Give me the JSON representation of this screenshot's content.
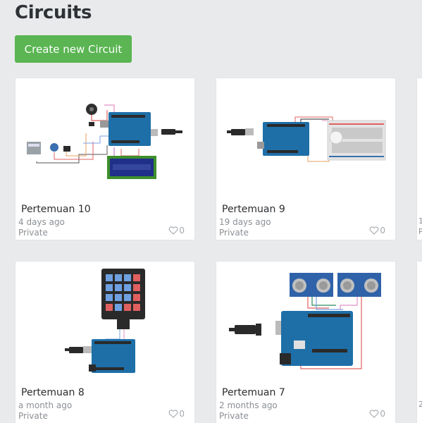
{
  "page": {
    "title": "Circuits"
  },
  "actions": {
    "create_label": "Create new Circuit"
  },
  "circuits": [
    {
      "name": "Pertemuan 10",
      "date": "4 days ago",
      "visibility": "Private",
      "likes": "0",
      "thumbnail": "arduino-lcd-circuit"
    },
    {
      "name": "Pertemuan 9",
      "date": "19 days ago",
      "visibility": "Private",
      "likes": "0",
      "thumbnail": "arduino-breadboard-circuit"
    },
    {
      "name": "Pertemuan 8",
      "date": "a month ago",
      "visibility": "Private",
      "likes": "0",
      "thumbnail": "arduino-keypad-circuit"
    },
    {
      "name": "Pertemuan 7",
      "date": "2 months ago",
      "visibility": "Private",
      "likes": "0",
      "thumbnail": "arduino-ultrasonic-circuit"
    }
  ],
  "partial_cards": [
    {
      "line1": "1",
      "line2": "P"
    },
    {
      "line1": "2",
      "line2": ""
    }
  ],
  "colors": {
    "accent": "#5ab552",
    "background": "#e9eaec",
    "arduino": "#1e6fa8"
  }
}
